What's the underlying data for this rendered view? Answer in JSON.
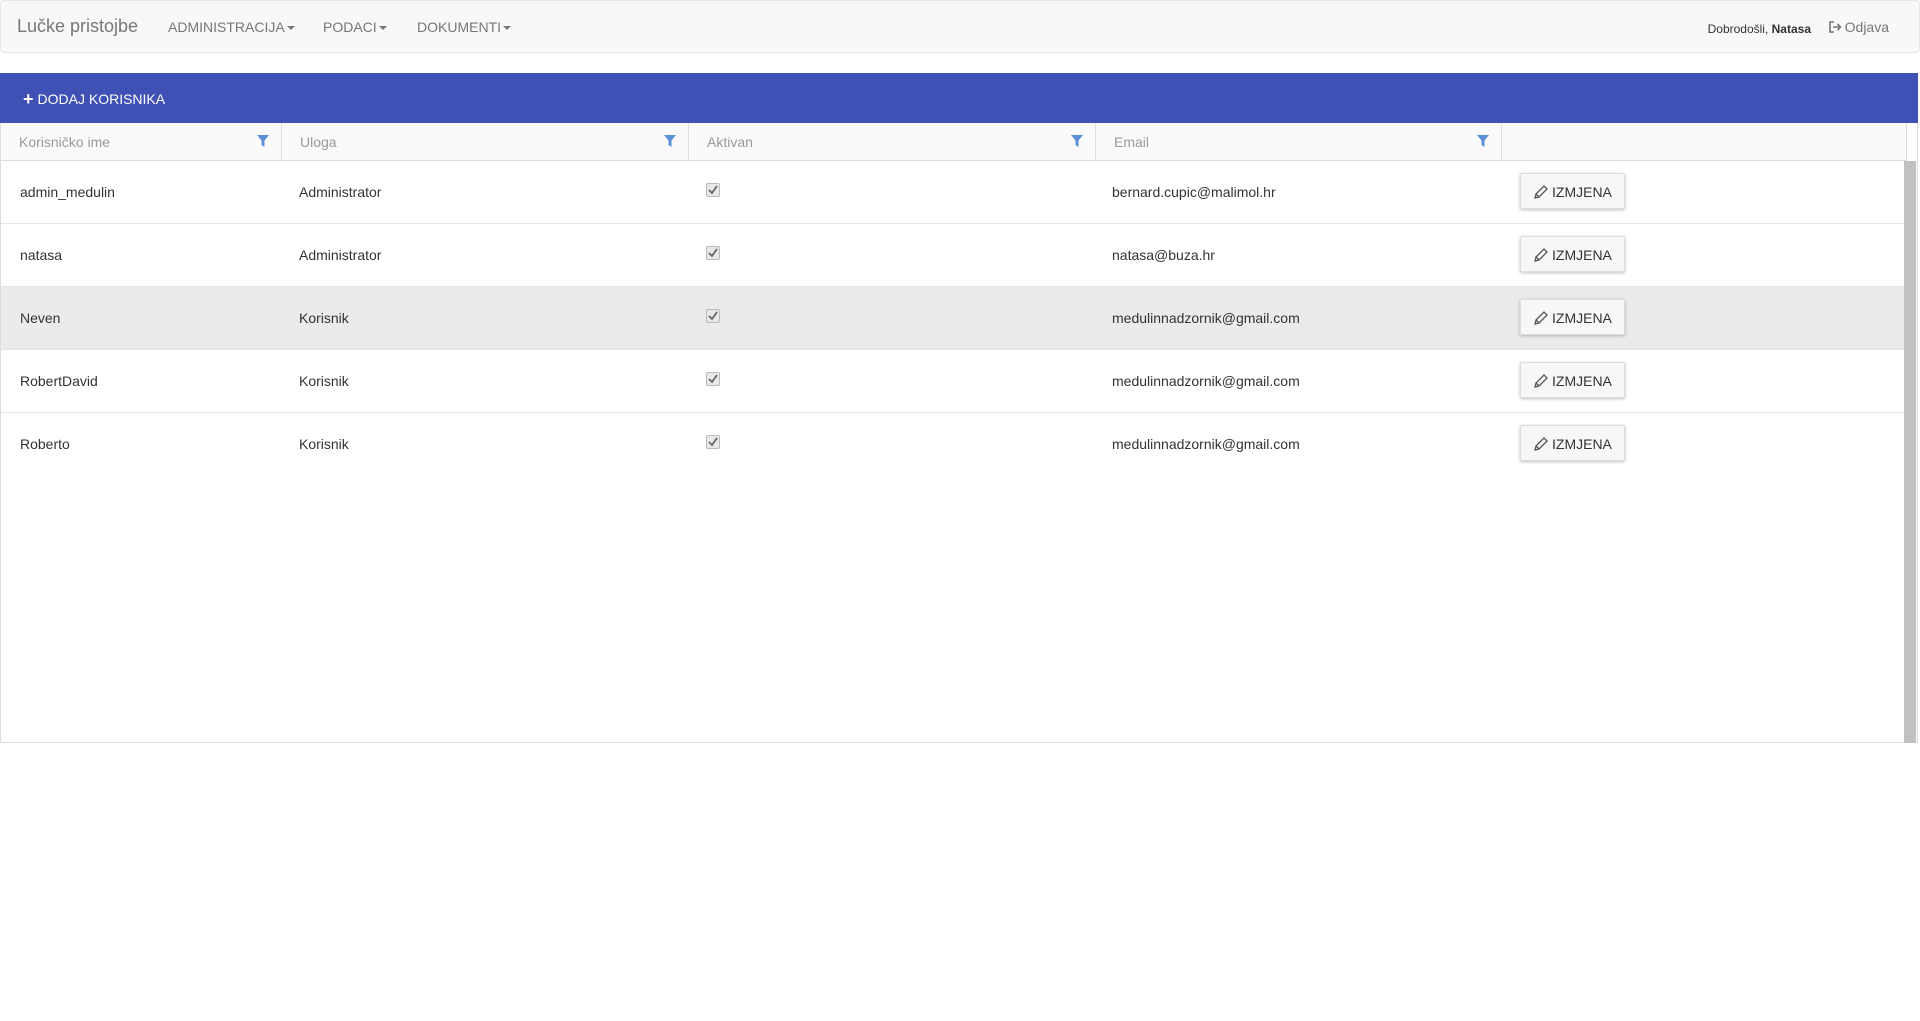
{
  "navbar": {
    "brand": "Lučke pristojbe",
    "menus": [
      "ADMINISTRACIJA",
      "PODACI",
      "DOKUMENTI"
    ],
    "welcome_prefix": "Dobrodošli, ",
    "user_name": "Natasa",
    "logout_label": "Odjava"
  },
  "toolbar": {
    "add_user_label": "DODAJ KORISNIKA"
  },
  "table": {
    "columns": [
      "Korisničko ime",
      "Uloga",
      "Aktivan",
      "Email",
      ""
    ],
    "rows": [
      {
        "username": "admin_medulin",
        "role": "Administrator",
        "active": true,
        "email": "bernard.cupic@malimol.hr"
      },
      {
        "username": "natasa",
        "role": "Administrator",
        "active": true,
        "email": "natasa@buza.hr"
      },
      {
        "username": "Neven",
        "role": "Korisnik",
        "active": true,
        "email": "medulinnadzornik@gmail.com"
      },
      {
        "username": "RobertDavid",
        "role": "Korisnik",
        "active": true,
        "email": "medulinnadzornik@gmail.com"
      },
      {
        "username": "Roberto",
        "role": "Korisnik",
        "active": true,
        "email": "medulinnadzornik@gmail.com"
      }
    ],
    "edit_label": "IZMJENA"
  },
  "icons": {
    "filter": "filter-icon",
    "pencil": "pencil-icon",
    "check": "check-icon",
    "logout": "sign-out-icon",
    "add": "plus-icon"
  },
  "colors": {
    "toolbar_bg": "#3f51b5",
    "filter_icon": "#5b8fd6",
    "hover_row": "#ebebeb"
  }
}
